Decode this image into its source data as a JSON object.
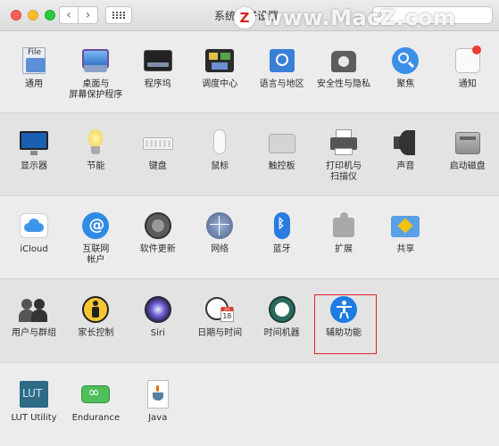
{
  "window": {
    "title": "系统偏好设置",
    "search_value": "",
    "watermark": "www.MacZ.com",
    "watermark_logo": "Z"
  },
  "toolbar": {
    "back_symbol": "‹",
    "forward_symbol": "›"
  },
  "rows": [
    [
      {
        "label": "通用",
        "icon": "general-icon"
      },
      {
        "label": "桌面与\n屏幕保护程序",
        "icon": "desktop-screensaver-icon"
      },
      {
        "label": "程序坞",
        "icon": "dock-icon"
      },
      {
        "label": "调度中心",
        "icon": "mission-control-icon"
      },
      {
        "label": "语言与地区",
        "icon": "language-region-icon"
      },
      {
        "label": "安全性与隐私",
        "icon": "security-privacy-icon"
      },
      {
        "label": "聚焦",
        "icon": "spotlight-icon"
      },
      {
        "label": "通知",
        "icon": "notifications-icon"
      }
    ],
    [
      {
        "label": "显示器",
        "icon": "displays-icon"
      },
      {
        "label": "节能",
        "icon": "energy-saver-icon"
      },
      {
        "label": "键盘",
        "icon": "keyboard-icon"
      },
      {
        "label": "鼠标",
        "icon": "mouse-icon"
      },
      {
        "label": "触控板",
        "icon": "trackpad-icon"
      },
      {
        "label": "打印机与\n扫描仪",
        "icon": "printers-scanners-icon"
      },
      {
        "label": "声音",
        "icon": "sound-icon"
      },
      {
        "label": "启动磁盘",
        "icon": "startup-disk-icon"
      }
    ],
    [
      {
        "label": "iCloud",
        "icon": "icloud-icon"
      },
      {
        "label": "互联网\n帐户",
        "icon": "internet-accounts-icon"
      },
      {
        "label": "软件更新",
        "icon": "software-update-icon"
      },
      {
        "label": "网络",
        "icon": "network-icon"
      },
      {
        "label": "蓝牙",
        "icon": "bluetooth-icon"
      },
      {
        "label": "扩展",
        "icon": "extensions-icon"
      },
      {
        "label": "共享",
        "icon": "sharing-icon"
      }
    ],
    [
      {
        "label": "用户与群组",
        "icon": "users-groups-icon"
      },
      {
        "label": "家长控制",
        "icon": "parental-controls-icon"
      },
      {
        "label": "Siri",
        "icon": "siri-icon"
      },
      {
        "label": "日期与时间",
        "icon": "date-time-icon"
      },
      {
        "label": "时间机器",
        "icon": "time-machine-icon"
      },
      {
        "label": "辅助功能",
        "icon": "accessibility-icon"
      }
    ],
    [
      {
        "label": "LUT Utility",
        "icon": "lut-utility-icon"
      },
      {
        "label": "Endurance",
        "icon": "endurance-icon"
      },
      {
        "label": "Java",
        "icon": "java-icon"
      }
    ]
  ],
  "icon_text": {
    "general": "File",
    "lut": "LUT",
    "calendar_day": "18",
    "calendar_month": "JUL"
  },
  "colors": {
    "highlight": "#e0242b",
    "accent_blue": "#1e7ce0"
  }
}
